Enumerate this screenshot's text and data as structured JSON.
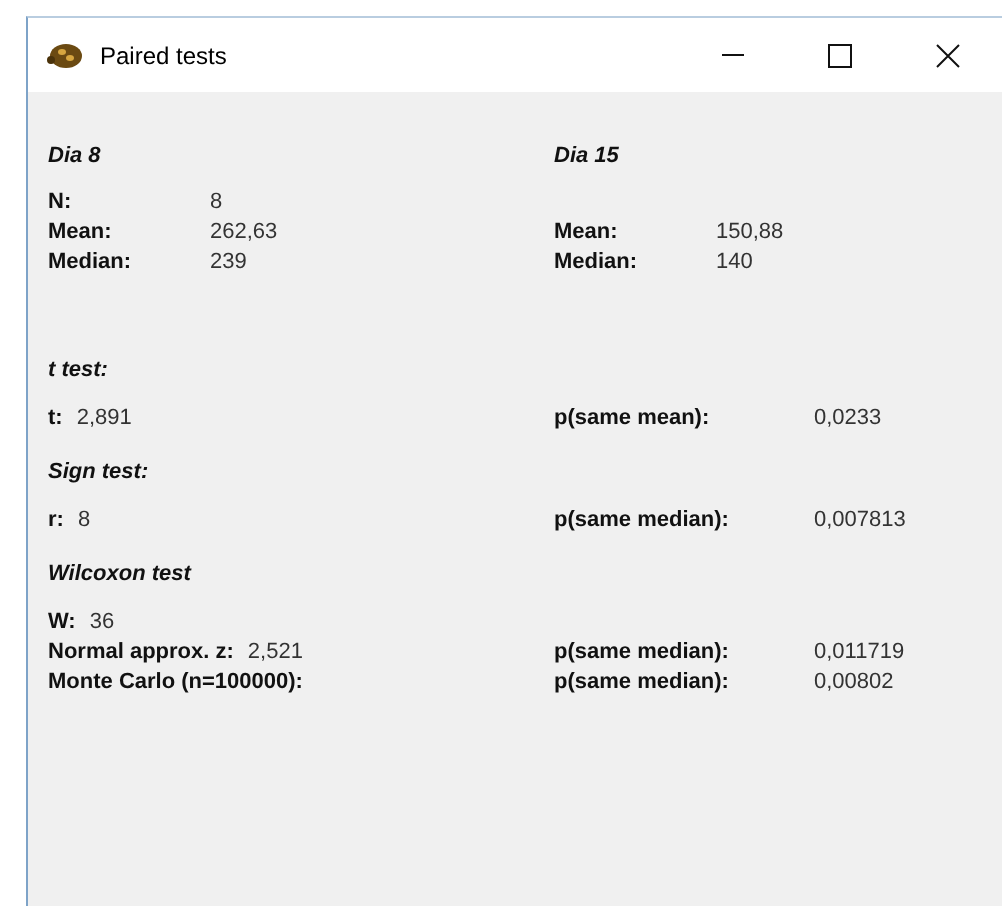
{
  "window": {
    "title": "Paired tests"
  },
  "summary": {
    "headings": [
      "Dia 8",
      "Dia 15"
    ],
    "rows": [
      {
        "left": {
          "label": "N:",
          "value": "8"
        }
      },
      {
        "left": {
          "label": "Mean:",
          "value": "262,63"
        },
        "right": {
          "label": "Mean:",
          "value": "150,88"
        }
      },
      {
        "left": {
          "label": "Median:",
          "value": "239"
        },
        "right": {
          "label": "Median:",
          "value": "140"
        }
      }
    ]
  },
  "tests": [
    {
      "heading": "t test:",
      "rows": [
        {
          "left": {
            "label": "t:",
            "value": "2,891"
          },
          "right": {
            "label": "p(same mean):",
            "value": "0,0233"
          }
        }
      ]
    },
    {
      "heading": "Sign test:",
      "rows": [
        {
          "left": {
            "label": "r:",
            "value": "8"
          },
          "right": {
            "label": "p(same median):",
            "value": "0,007813"
          }
        }
      ]
    },
    {
      "heading": "Wilcoxon test",
      "rows": [
        {
          "left": {
            "label": "W:",
            "value": "36"
          }
        },
        {
          "left": {
            "label": "Normal approx. z:",
            "value": "2,521"
          },
          "right": {
            "label": "p(same median):",
            "value": "0,011719"
          }
        },
        {
          "left": {
            "label": "Monte Carlo (n=100000):"
          },
          "right": {
            "label": "p(same median):",
            "value": "0,00802"
          }
        }
      ]
    }
  ]
}
